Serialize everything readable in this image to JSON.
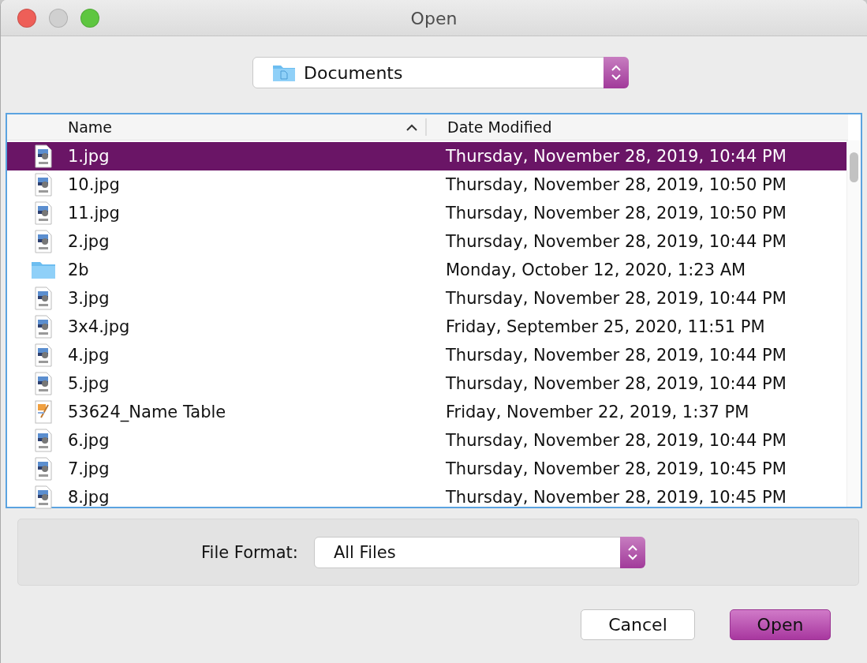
{
  "window": {
    "title": "Open",
    "controls": [
      {
        "kind": "close",
        "disabled": false
      },
      {
        "kind": "minimize",
        "disabled": true
      },
      {
        "kind": "zoom",
        "disabled": false
      }
    ]
  },
  "location": {
    "value": "Documents"
  },
  "table": {
    "columns": [
      {
        "label": "Name",
        "sorted": true
      },
      {
        "label": "Date Modified",
        "sorted": false
      }
    ],
    "rows": [
      {
        "kind": "jpeg",
        "name": "1.jpg",
        "date": "Thursday, November 28, 2019, 10:44 PM",
        "selected": true
      },
      {
        "kind": "jpeg",
        "name": "10.jpg",
        "date": "Thursday, November 28, 2019, 10:50 PM",
        "selected": false
      },
      {
        "kind": "jpeg",
        "name": "11.jpg",
        "date": "Thursday, November 28, 2019, 10:50 PM",
        "selected": false
      },
      {
        "kind": "jpeg",
        "name": "2.jpg",
        "date": "Thursday, November 28, 2019, 10:44 PM",
        "selected": false
      },
      {
        "kind": "folder",
        "name": "2b",
        "date": "Monday, October 12, 2020, 1:23 AM",
        "selected": false
      },
      {
        "kind": "jpeg",
        "name": "3.jpg",
        "date": "Thursday, November 28, 2019, 10:44 PM",
        "selected": false
      },
      {
        "kind": "jpeg",
        "name": "3x4.jpg",
        "date": "Friday, September 25, 2020, 11:51 PM",
        "selected": false
      },
      {
        "kind": "jpeg",
        "name": "4.jpg",
        "date": "Thursday, November 28, 2019, 10:44 PM",
        "selected": false
      },
      {
        "kind": "jpeg",
        "name": "5.jpg",
        "date": "Thursday, November 28, 2019, 10:44 PM",
        "selected": false
      },
      {
        "kind": "document",
        "name": "53624_Name Table",
        "date": "Friday, November 22, 2019, 1:37 PM",
        "selected": false
      },
      {
        "kind": "jpeg",
        "name": "6.jpg",
        "date": "Thursday, November 28, 2019, 10:44 PM",
        "selected": false
      },
      {
        "kind": "jpeg",
        "name": "7.jpg",
        "date": "Thursday, November 28, 2019, 10:45 PM",
        "selected": false
      },
      {
        "kind": "jpeg",
        "name": "8.jpg",
        "date": "Thursday, November 28, 2019, 10:45 PM",
        "selected": false
      }
    ]
  },
  "file_format": {
    "label": "File Format:",
    "value": "All Files"
  },
  "buttons": [
    {
      "label": "Cancel",
      "default": false
    },
    {
      "label": "Open",
      "default": true
    }
  ]
}
